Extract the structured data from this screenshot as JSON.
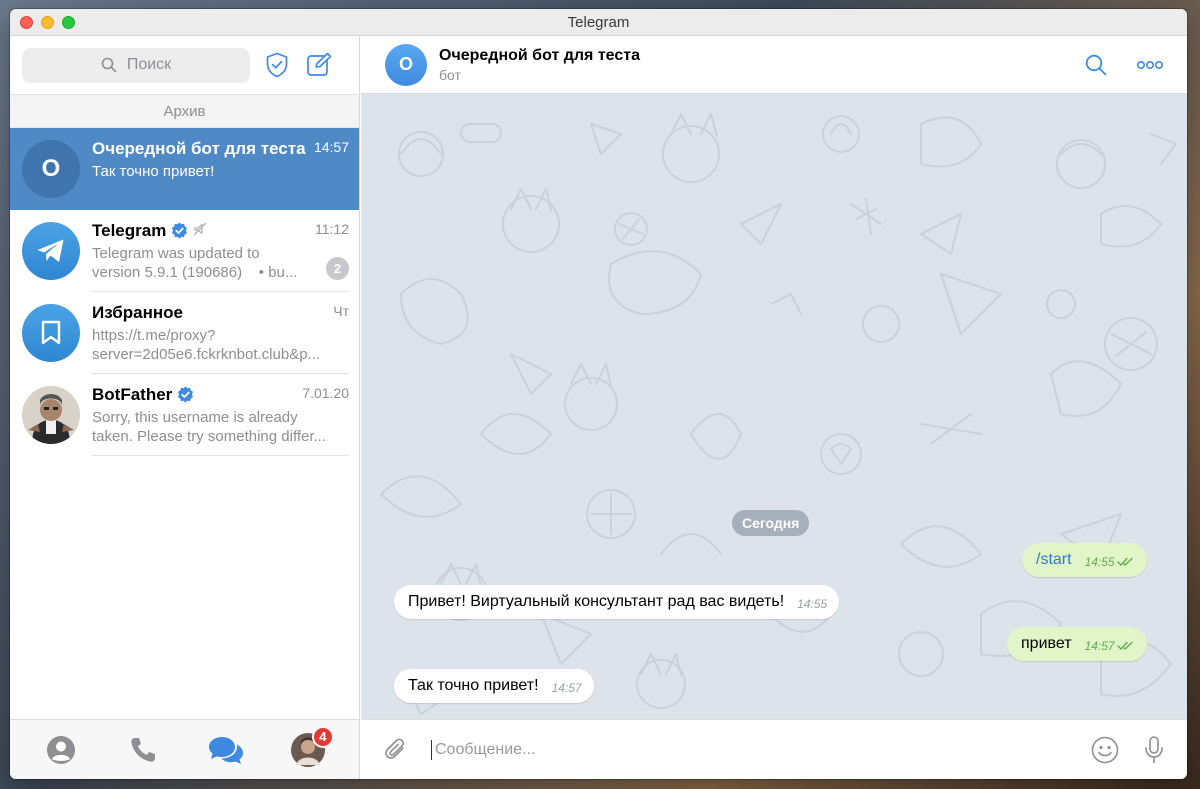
{
  "window": {
    "title": "Telegram"
  },
  "sidebar": {
    "search_placeholder": "Поиск",
    "archive_label": "Архив",
    "chats": [
      {
        "name": "Очередной бот для теста",
        "time": "14:57",
        "line1": "Так точно привет!",
        "line2": "",
        "avatar_letter": "О",
        "avatar_color": "#3f74ad",
        "active": true
      },
      {
        "name": "Telegram",
        "time": "11:12",
        "line1": "Telegram was updated to",
        "line2": "version 5.9.1 (190686)",
        "line2_suffix": "•  bu...",
        "badge": "2",
        "verified": true,
        "muted": true
      },
      {
        "name": "Избранное",
        "time": "Чт",
        "line1": "https://t.me/proxy?",
        "line2": "server=2d05e6.fckrknbot.club&p..."
      },
      {
        "name": "BotFather",
        "time": "7.01.20",
        "line1": "Sorry, this username is already",
        "line2": "taken. Please try something differ...",
        "verified": true
      }
    ],
    "tabs": {
      "profile_badge": "4"
    }
  },
  "header": {
    "avatar_letter": "О",
    "title": "Очередной бот для теста",
    "subtitle": "бот"
  },
  "messages": {
    "date_separator": "Сегодня",
    "items": [
      {
        "dir": "out",
        "text": "/start",
        "time": "14:55"
      },
      {
        "dir": "in",
        "text": "Привет! Виртуальный консультант рад вас видеть!",
        "time": "14:55"
      },
      {
        "dir": "out",
        "text": "привет",
        "time": "14:57"
      },
      {
        "dir": "in",
        "text": "Так точно привет!",
        "time": "14:57"
      }
    ]
  },
  "composer": {
    "placeholder": "Сообщение..."
  },
  "colors": {
    "accent": "#4f89c6",
    "outgoing_bubble": "#e1f5c9",
    "chat_bg": "#dde3ea",
    "badge_red": "#e53935"
  }
}
